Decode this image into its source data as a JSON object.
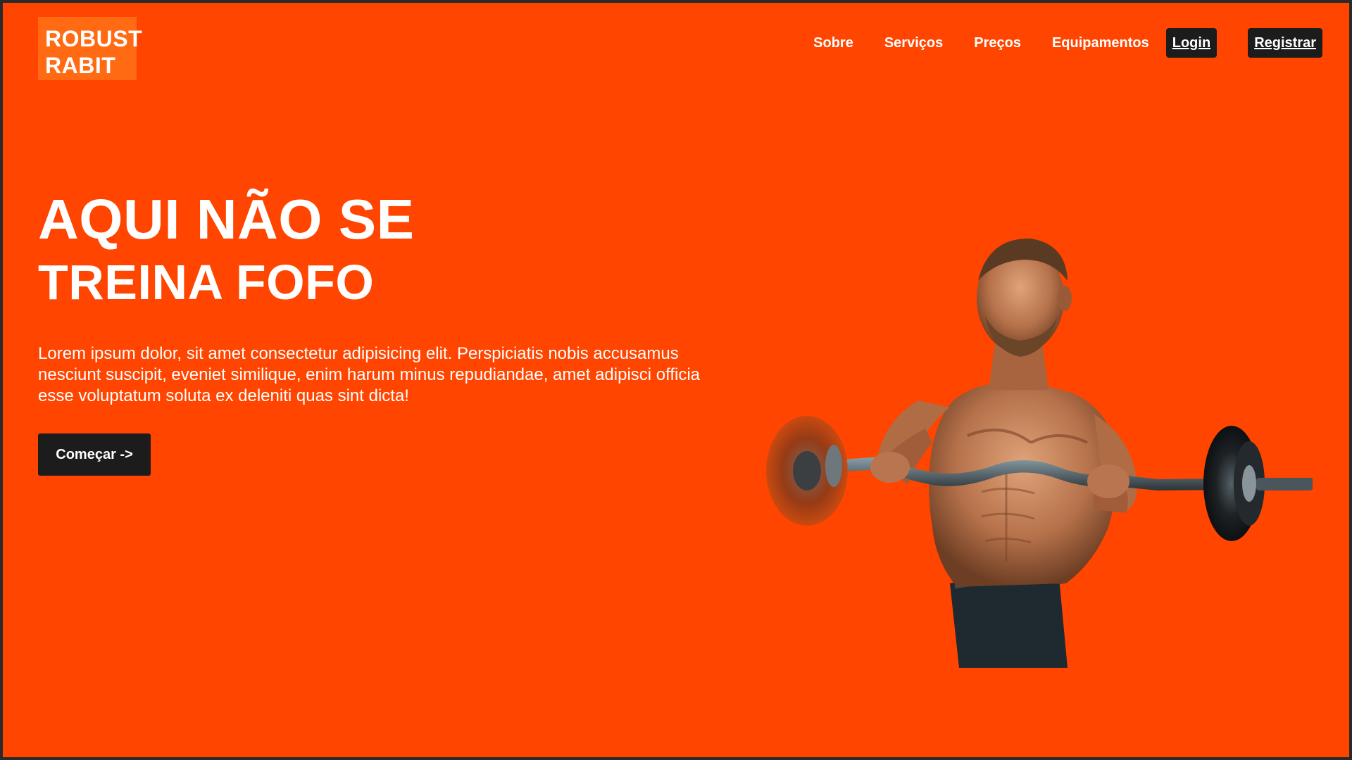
{
  "logo": {
    "line1": "ROBUST",
    "line2": "RABIT"
  },
  "nav": {
    "links": [
      "Sobre",
      "Serviços",
      "Preços",
      "Equipamentos"
    ],
    "login": "Login",
    "register": "Registrar"
  },
  "hero": {
    "title_line1": "AQUI NÃO SE",
    "title_line2": "TREINA FOFO",
    "text": "Lorem ipsum dolor, sit amet consectetur adipisicing elit. Perspiciatis nobis accusamus nesciunt suscipit, eveniet similique, enim harum minus repudiandae, amet adipisci officia esse voluptatum soluta ex deleniti quas sint dicta!",
    "cta": "Começar ->"
  },
  "colors": {
    "background": "#ff4500",
    "logo_bg": "#ff6a13",
    "button_bg": "#1c1c1c",
    "text": "#ffffff"
  },
  "image": {
    "subject": "athlete-with-barbell"
  }
}
